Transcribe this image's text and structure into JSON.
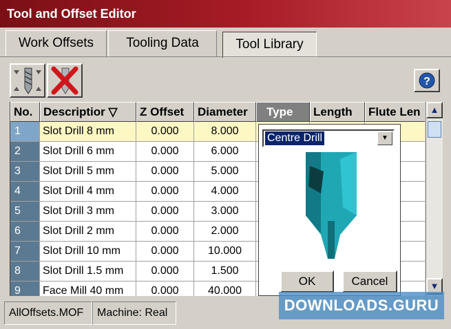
{
  "window": {
    "title": "Tool and Offset Editor"
  },
  "tabs": [
    {
      "label": "Work Offsets"
    },
    {
      "label": "Tooling Data"
    },
    {
      "label": "Tool Library",
      "active": true
    }
  ],
  "toolbar": {
    "add_icon": "drill-bit-icon",
    "delete_icon": "red-x-delete-icon",
    "help_icon": "help-question-icon",
    "help_label": "?"
  },
  "grid": {
    "columns": [
      "No.",
      "Descriptior ▽",
      "Z Offset",
      "Diameter",
      "Type",
      "Length",
      "Flute Len"
    ],
    "rows": [
      {
        "no": "1",
        "desc": "Slot Drill 8 mm",
        "z": "0.000",
        "dia": "8.000"
      },
      {
        "no": "2",
        "desc": "Slot Drill 6 mm",
        "z": "0.000",
        "dia": "6.000"
      },
      {
        "no": "3",
        "desc": "Slot Drill 5 mm",
        "z": "0.000",
        "dia": "5.000"
      },
      {
        "no": "4",
        "desc": "Slot Drill 4 mm",
        "z": "0.000",
        "dia": "4.000"
      },
      {
        "no": "5",
        "desc": "Slot Drill 3 mm",
        "z": "0.000",
        "dia": "3.000"
      },
      {
        "no": "6",
        "desc": "Slot Drill 2 mm",
        "z": "0.000",
        "dia": "2.000"
      },
      {
        "no": "7",
        "desc": "Slot Drill 10 mm",
        "z": "0.000",
        "dia": "10.000"
      },
      {
        "no": "8",
        "desc": "Slot Drill 1.5 mm",
        "z": "0.000",
        "dia": "1.500"
      },
      {
        "no": "9",
        "desc": "Face Mill 40 mm",
        "z": "0.000",
        "dia": "40.000"
      }
    ]
  },
  "type_popup": {
    "selected": "Centre Drill",
    "preview_icon": "centre-drill-3d-icon",
    "ok": "OK",
    "cancel": "Cancel"
  },
  "status": {
    "file": "AllOffsets.MOF",
    "machine": "Machine: Real"
  },
  "watermark": {
    "text": "DOWNLOADS",
    "suffix": ".GURU"
  },
  "colors": {
    "title_bar": "#a71c26",
    "selected_row": "#fdf7c4",
    "row_number_bg": "#5b7a92",
    "drill_color": "#1fa7b4"
  }
}
